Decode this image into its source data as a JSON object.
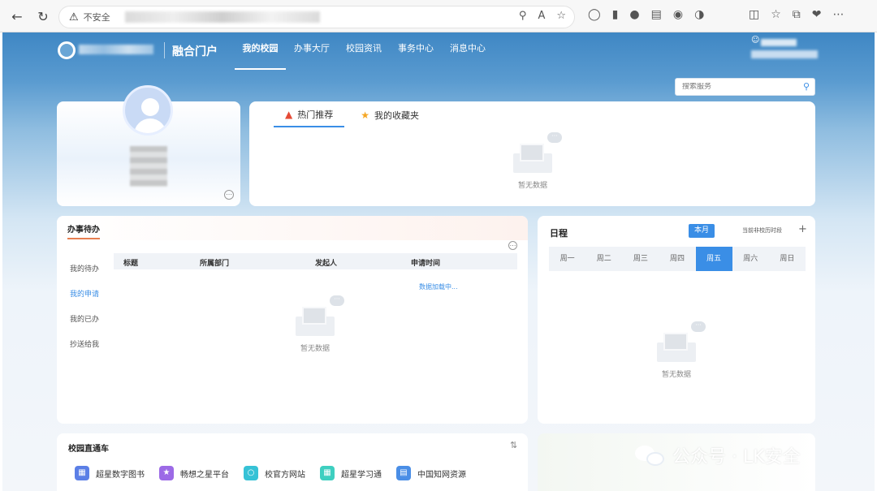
{
  "browser": {
    "security_label": "不安全",
    "toolbar_icons": [
      "back-icon",
      "refresh-icon"
    ]
  },
  "header": {
    "portal_title": "融合门户",
    "nav": [
      "我的校园",
      "办事大厅",
      "校园资讯",
      "事务中心",
      "消息中心"
    ]
  },
  "search": {
    "placeholder": "搜索服务"
  },
  "hot": {
    "tabs": [
      "热门推荐",
      "我的收藏夹"
    ],
    "empty_text": "暂无数据"
  },
  "todo": {
    "title": "办事待办",
    "side_items": [
      "我的待办",
      "我的申请",
      "我的已办",
      "抄送给我"
    ],
    "columns": [
      "标题",
      "所属部门",
      "发起人",
      "申请时间"
    ],
    "loading_text": "数据加载中...",
    "empty_text": "暂无数据"
  },
  "schedule": {
    "title": "日程",
    "month_button": "本月",
    "current_week": "当前非校历时段",
    "plus": "+",
    "days": [
      "周一",
      "周二",
      "周三",
      "周四",
      "周五",
      "周六",
      "周日"
    ],
    "active_day": "周五",
    "empty_text": "暂无数据"
  },
  "campus": {
    "title": "校园直通车",
    "links": [
      {
        "label": "超星数字图书",
        "color": "#5b7fe6",
        "icon": "book-icon"
      },
      {
        "label": "畅想之星平台",
        "color": "#9c6ae6",
        "icon": "star-platform-icon"
      },
      {
        "label": "校官方网站",
        "color": "#36c2d6",
        "icon": "globe-icon"
      },
      {
        "label": "超星学习通",
        "color": "#3ecfc0",
        "icon": "study-icon"
      },
      {
        "label": "中国知网资源",
        "color": "#4a8ee6",
        "icon": "cnki-icon"
      }
    ]
  },
  "watermark": {
    "text": "公众号 · LK安全"
  }
}
